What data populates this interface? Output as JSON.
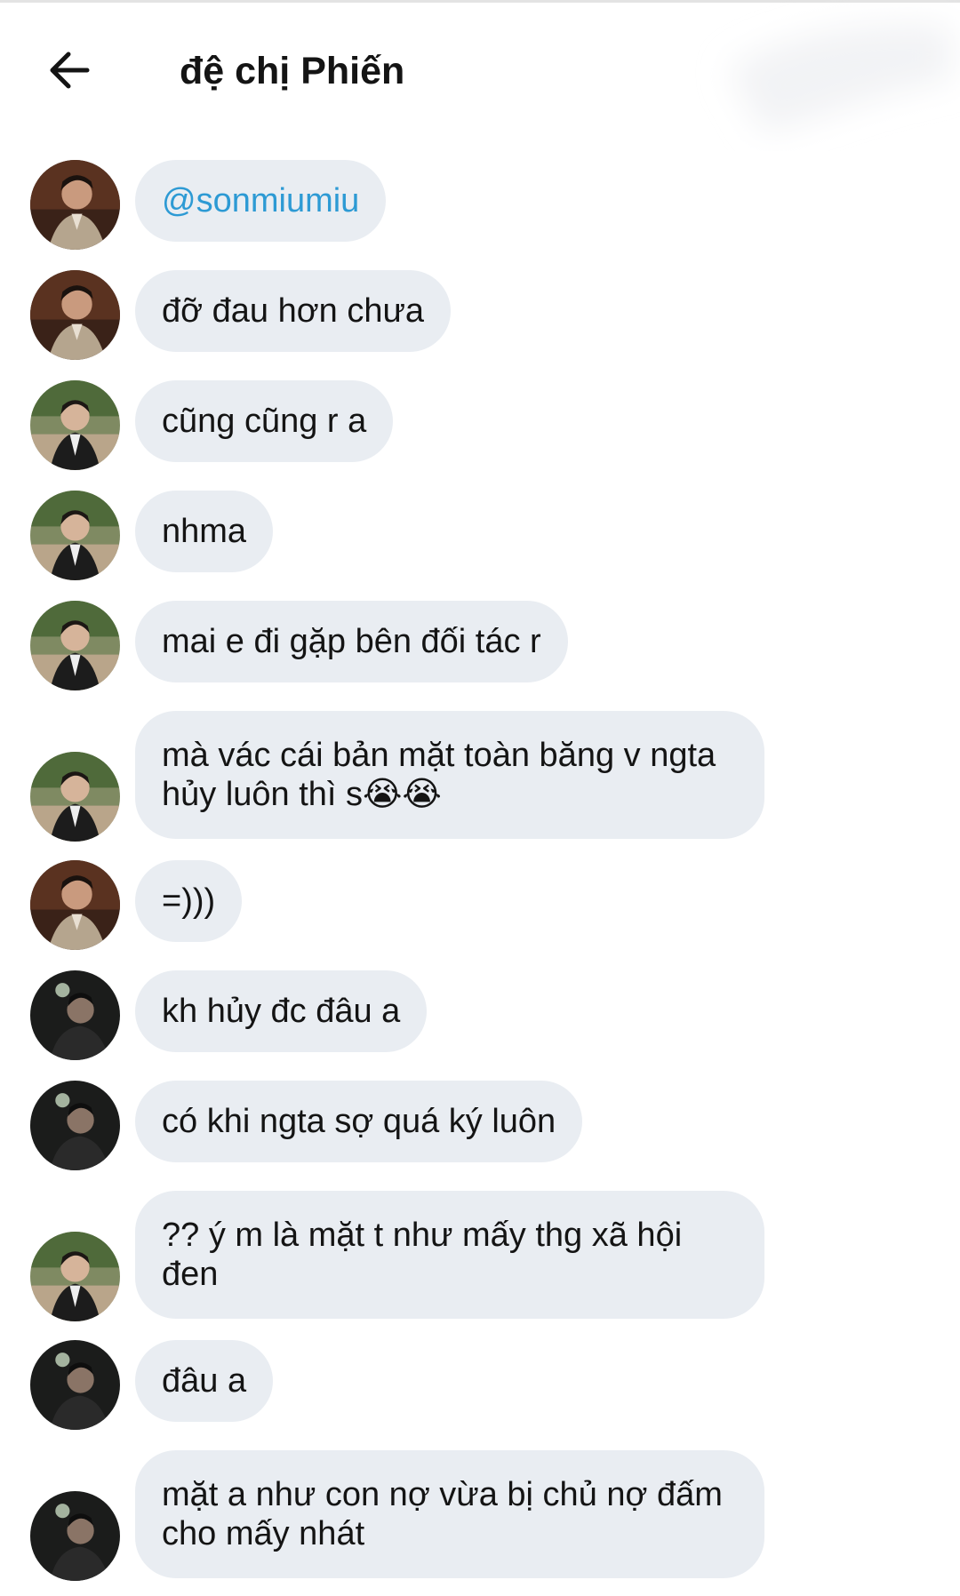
{
  "header": {
    "back_icon": "arrow-left-icon",
    "title": "đệ chị Phiến"
  },
  "colors": {
    "bubble_bg": "#e9edf2",
    "mention": "#2d9ad4",
    "text": "#141414"
  },
  "messages": [
    {
      "sender": "avatar-a",
      "lines": [
        "@sonmiumiu"
      ],
      "mention": true
    },
    {
      "sender": "avatar-a",
      "lines": [
        "đỡ đau hơn chưa"
      ]
    },
    {
      "sender": "avatar-b",
      "lines": [
        "cũng cũng r a"
      ]
    },
    {
      "sender": "avatar-b",
      "lines": [
        "nhma"
      ]
    },
    {
      "sender": "avatar-b",
      "lines": [
        "mai e đi gặp bên đối tác r"
      ]
    },
    {
      "sender": "avatar-b",
      "lines": [
        "mà vác cái bản mặt toàn băng v ngta",
        "hủy luôn thì s😭😭"
      ]
    },
    {
      "sender": "avatar-a",
      "lines": [
        "=)))"
      ]
    },
    {
      "sender": "avatar-c",
      "lines": [
        "kh hủy đc đâu a"
      ]
    },
    {
      "sender": "avatar-c",
      "lines": [
        "có khi ngta sợ quá ký luôn"
      ]
    },
    {
      "sender": "avatar-b",
      "lines": [
        "?? ý m là mặt t như mấy thg xã hội",
        "đen"
      ]
    },
    {
      "sender": "avatar-c",
      "lines": [
        "đâu a"
      ]
    },
    {
      "sender": "avatar-c",
      "lines": [
        "mặt a như con nợ vừa bị chủ nợ đấm",
        "cho mấy nhát"
      ]
    }
  ]
}
